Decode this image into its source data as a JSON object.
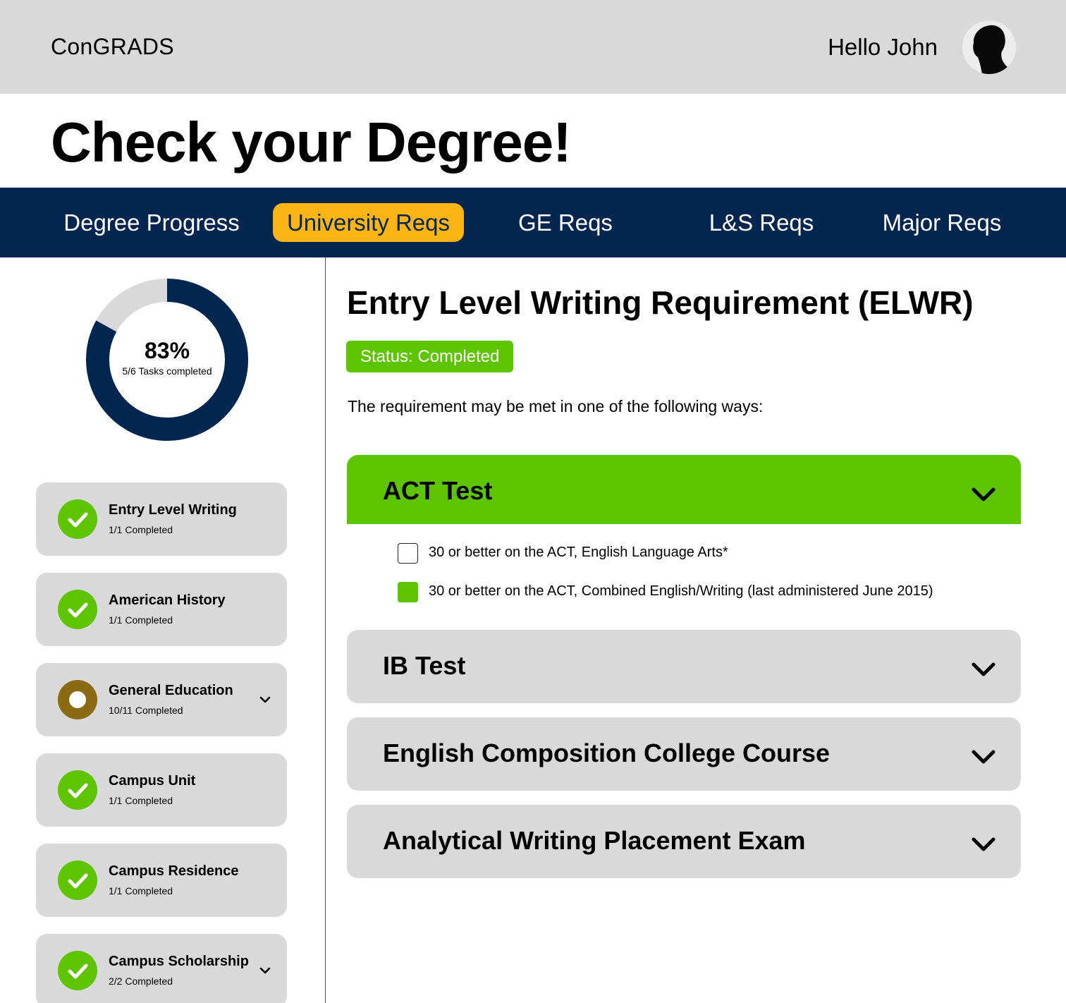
{
  "header": {
    "brand": "ConGRADS",
    "greeting": "Hello John",
    "avatar_icon": "user-silhouette-icon"
  },
  "page_title": "Check your Degree!",
  "tabs": [
    {
      "label": "Degree Progress",
      "active": false
    },
    {
      "label": "University Reqs",
      "active": true
    },
    {
      "label": "GE Reqs",
      "active": false
    },
    {
      "label": "L&S Reqs",
      "active": false
    },
    {
      "label": "Major Reqs",
      "active": false
    }
  ],
  "progress": {
    "percent_label": "83%",
    "fraction": 0.83,
    "subtitle": "5/6 Tasks completed"
  },
  "requirements": [
    {
      "name": "Entry Level Writing",
      "count": "1/1 Completed",
      "status": "complete",
      "expandable": false
    },
    {
      "name": "American History",
      "count": "1/1 Completed",
      "status": "complete",
      "expandable": false
    },
    {
      "name": "General Education",
      "count": "10/11 Completed",
      "status": "in-progress",
      "expandable": true
    },
    {
      "name": "Campus Unit",
      "count": "1/1 Completed",
      "status": "complete",
      "expandable": false
    },
    {
      "name": "Campus Residence",
      "count": "1/1 Completed",
      "status": "complete",
      "expandable": false
    },
    {
      "name": "Campus Scholarship",
      "count": "2/2 Completed",
      "status": "complete",
      "expandable": true
    }
  ],
  "detail": {
    "title": "Entry Level Writing Requirement (ELWR)",
    "status": "Status: Completed",
    "intro": "The requirement may be met in one of the following ways:",
    "options_groups": [
      {
        "title": "ACT Test",
        "expanded": true,
        "items": [
          {
            "text": "30 or better on the ACT, English Language Arts*",
            "checked": false
          },
          {
            "text": "30 or better on the ACT, Combined English/Writing (last administered June 2015)",
            "checked": true
          }
        ]
      },
      {
        "title": "IB Test",
        "expanded": false
      },
      {
        "title": "English Composition College Course",
        "expanded": false
      },
      {
        "title": "Analytical Writing Placement Exam",
        "expanded": false
      }
    ]
  },
  "colors": {
    "navy": "#032650",
    "gold": "#fdb515",
    "green": "#5ec400",
    "gray": "#d9d9d9",
    "in_progress": "#8a6a12"
  }
}
